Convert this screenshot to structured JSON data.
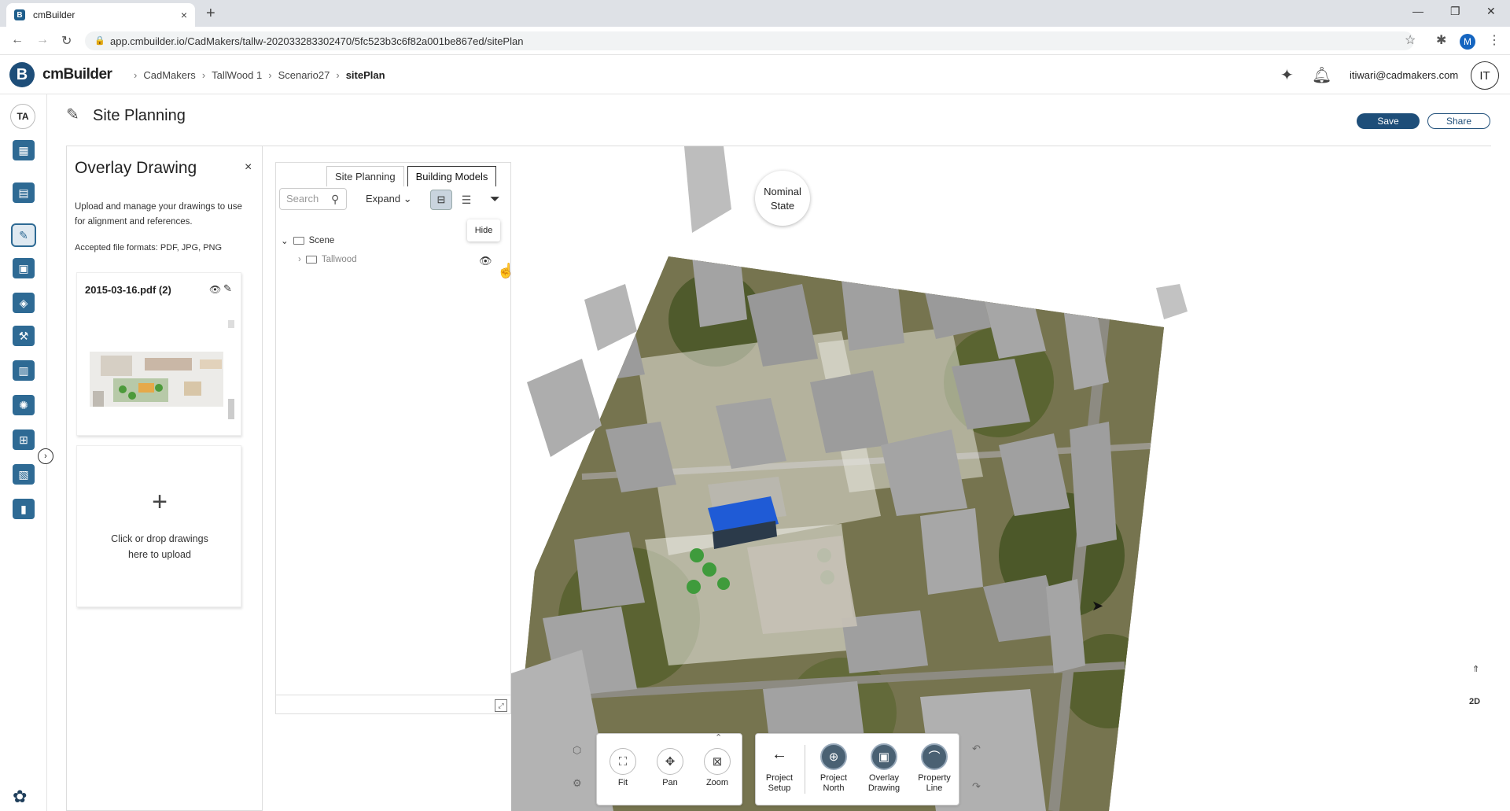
{
  "browser": {
    "tab_title": "cmBuilder",
    "tab_close": "×",
    "new_tab": "+",
    "url": "app.cmbuilder.io/CadMakers/tallw-202033283302470/5fc523b3c6f82a001be867ed/sitePlan",
    "profile_initial": "M"
  },
  "header": {
    "logo_letter": "B",
    "logo_text": "cmBuilder",
    "breadcrumbs": [
      "CadMakers",
      "TallWood 1",
      "Scenario27",
      "sitePlan"
    ],
    "user_email": "itiwari@cadmakers.com",
    "user_initials": "IT"
  },
  "rail": {
    "user_initials": "TA"
  },
  "page": {
    "title": "Site Planning",
    "save_label": "Save",
    "share_label": "Share"
  },
  "overlay_panel": {
    "title": "Overlay Drawing",
    "close": "×",
    "description": "Upload and manage your drawings to use for alignment and references.",
    "formats": "Accepted file formats: PDF, JPG, PNG",
    "drawing_name": "2015-03-16.pdf (2)",
    "upload_plus": "+",
    "upload_text_1": "Click or drop drawings",
    "upload_text_2": "here to upload"
  },
  "models_panel": {
    "tabs": [
      "Site Planning",
      "Building Models"
    ],
    "active_tab": "Building Models",
    "search_placeholder": "Search",
    "expand_label": "Expand",
    "tooltip": "Hide",
    "tree": [
      {
        "label": "Scene"
      },
      {
        "label": "Tallwood"
      }
    ]
  },
  "map": {
    "nominal_line1": "Nominal",
    "nominal_line2": "State",
    "view_mode": "2D"
  },
  "toolbar": {
    "tools": [
      {
        "label": "Fit"
      },
      {
        "label": "Pan"
      },
      {
        "label": "Zoom"
      }
    ],
    "setup": {
      "line1": "Project",
      "line2": "Setup"
    },
    "actions": [
      {
        "line1": "Project",
        "line2": "North"
      },
      {
        "line1": "Overlay",
        "line2": "Drawing"
      },
      {
        "line1": "Property",
        "line2": "Line"
      }
    ]
  },
  "colors": {
    "brand": "#1e4e79",
    "rail_icon": "#2e6a94",
    "building_highlight": "#1f5bd6"
  }
}
